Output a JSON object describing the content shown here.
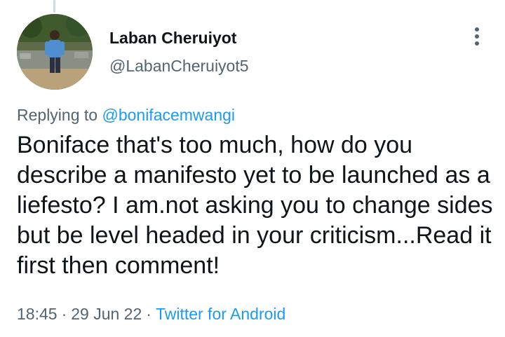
{
  "author": {
    "name": "Laban Cheruiyot",
    "handle": "@LabanCheruiyot5"
  },
  "reply": {
    "prefix": "Replying to",
    "mention": "@bonifacemwangi"
  },
  "tweet": {
    "text": "Boniface that's too much, how do you describe a manifesto yet to be launched as a liefesto? I am.not asking you to change sides but be level headed in your criticism...Read it first then comment!"
  },
  "meta": {
    "time": "18:45",
    "separator": "·",
    "date": "29 Jun 22",
    "source": "Twitter for Android"
  },
  "icons": {
    "more": "more-vertical-icon",
    "avatar": "profile-photo"
  },
  "colors": {
    "link": "#1d9bf0",
    "secondary": "#536471",
    "primary": "#0f1419",
    "thread_line": "#cfd9de"
  }
}
